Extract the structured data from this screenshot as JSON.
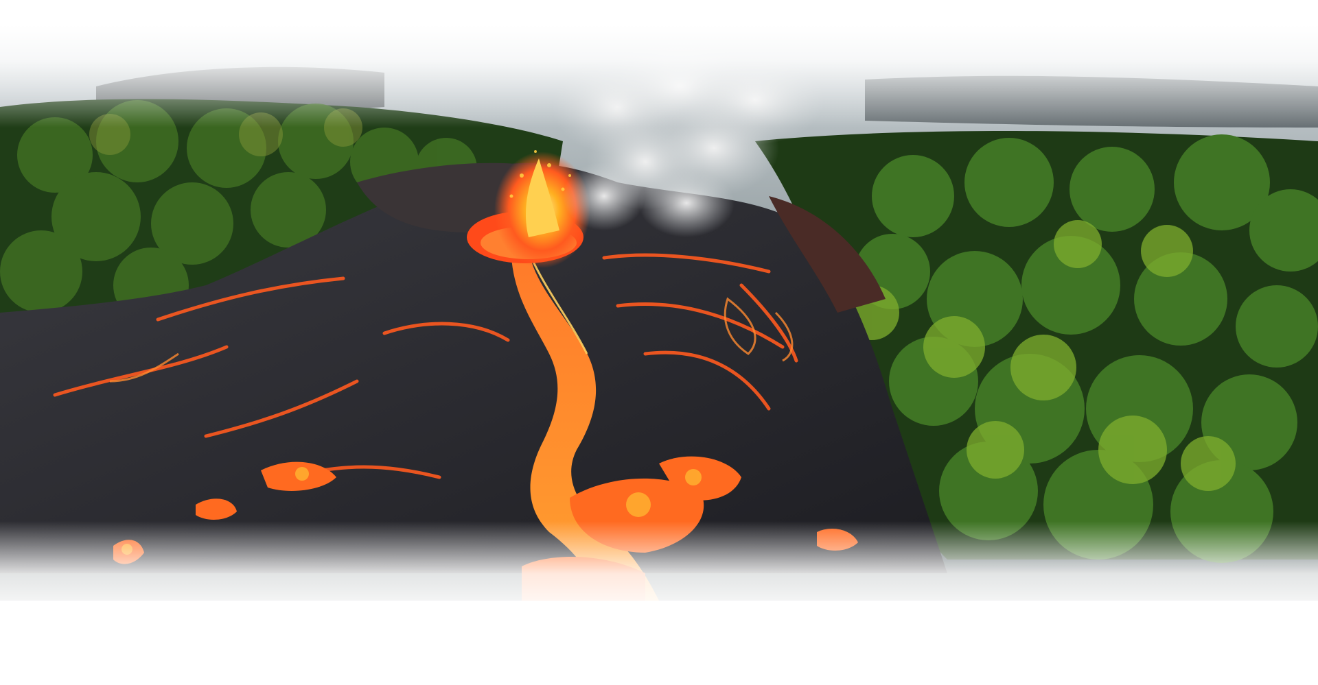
{
  "scene": {
    "subject": "volcano-eruption",
    "palette": {
      "lava": "#ff5a1f",
      "lava_hot": "#ffb020",
      "rock": "#2b2b30",
      "forest": "#2f5a1e",
      "forest_light": "#6e9a2a",
      "smoke": "#e6e6e6",
      "background": "#ffffff"
    }
  }
}
